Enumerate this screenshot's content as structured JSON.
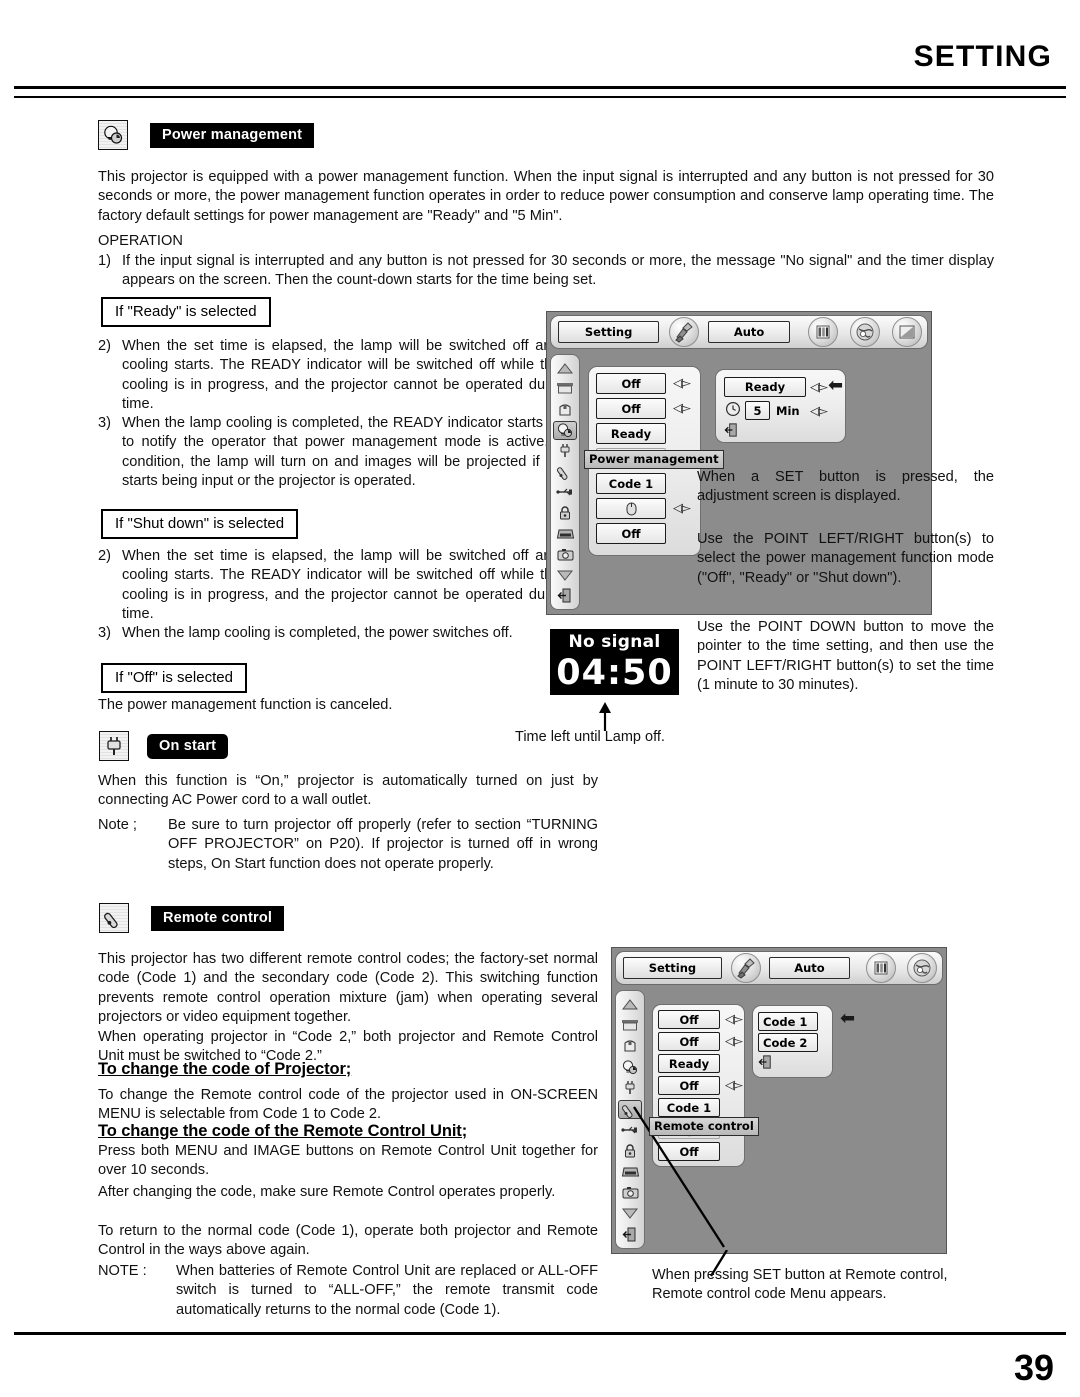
{
  "header": {
    "title": "SETTING"
  },
  "footer": {
    "page_number": "39"
  },
  "sections": {
    "power_management": {
      "icon": "power-management-icon",
      "label": "Power management",
      "intro": "This projector is equipped with a power management function. When the input signal is interrupted and any button is not pressed for 30 seconds or more, the power management function operates in order to reduce power consumption and conserve lamp operating time. The factory default settings for power management are \"Ready\" and \"5 Min\".",
      "operation_label": "OPERATION",
      "step1_num": "1)",
      "step1": "If the input signal is interrupted and any button is not pressed for 30 seconds or more, the message \"No signal\" and the timer display appears on the screen. Then the count-down starts for the time being set.",
      "ready_box": "If \"Ready\" is selected",
      "ready_step2_num": "2)",
      "ready_step2": "When the set time is elapsed, the lamp will be switched off and lamp cooling starts. The READY indicator will be switched off while the lamp cooling is in progress, and the projector cannot be operated during this time.",
      "ready_step3_num": "3)",
      "ready_step3": "When the lamp cooling is completed, the READY indicator starts flashing to notify the operator that power management mode is active. In this condition, the lamp will turn on and images will be projected if a signal starts being input or the projector is operated.",
      "shutdown_box": "If \"Shut down\" is selected",
      "shutdown_step2_num": "2)",
      "shutdown_step2": "When the set time is elapsed, the lamp will be switched off and lamp cooling starts. The READY indicator will be switched off while the lamp cooling is in progress, and the projector cannot be operated during this time.",
      "shutdown_step3_num": "3)",
      "shutdown_step3": "When the lamp cooling is completed, the power switches off.",
      "off_box": "If \"Off\" is selected",
      "off_text": "The power management function is canceled."
    },
    "on_start": {
      "icon": "power-plug-icon",
      "label": "On start",
      "body": "When this function is “On,” projector is automatically turned on just by connecting AC Power cord to a wall outlet.",
      "note_label": "Note ;",
      "note_body": "Be sure to turn projector off properly (refer to section “TURNING OFF PROJECTOR” on P20).  If projector is turned off in wrong steps, On Start function does not operate properly."
    },
    "remote_control": {
      "icon": "remote-control-icon",
      "label": "Remote control",
      "p1": "This projector has two different remote control codes; the factory-set normal code (Code 1) and the secondary code (Code 2).  This switching function prevents remote control operation mixture (jam) when operating several projectors or video equipment together.",
      "p2": "When operating projector in “Code 2,”  both projector and Remote Control Unit must be switched to “Code 2.”",
      "head1": "To change the code of Projector;",
      "p3": "To change the Remote control code of the projector used in ON-SCREEN MENU is selectable from Code 1 to Code 2.",
      "head2": "To change the code of the Remote Control Unit;",
      "p4": "Press both MENU and IMAGE buttons on Remote Control Unit together for over 10 seconds.",
      "p5": "After changing the code, make sure Remote Control operates properly.",
      "p6": "To return to the normal code (Code 1), operate both projector and Remote Control in the ways above again.",
      "note_label": "NOTE :",
      "note_body": "When batteries of Remote Control Unit are replaced or ALL-OFF switch is turned to “ALL-OFF,” the remote transmit code automatically returns to the normal code (Code 1)."
    }
  },
  "osd_top": {
    "menu_button": "Setting",
    "auto_button": "Auto",
    "sidebar_icons": [
      "scroll-up-icon",
      "screen-icon",
      "lamp-box-icon",
      "power-management-icon",
      "power-plug-icon",
      "remote-control-icon",
      "usb-icon",
      "lock-icon",
      "keystone-icon",
      "capture-icon",
      "scroll-down-icon",
      "exit-icon"
    ],
    "rows": [
      {
        "value": "Off",
        "has_lr": true
      },
      {
        "value": "Off",
        "has_lr": true
      },
      {
        "value": "Ready",
        "has_lr": false
      },
      {
        "value": "Off",
        "has_lr": true
      },
      {
        "value": "Code 1",
        "has_lr": false
      },
      {
        "value": "mouse-icon",
        "has_lr": true
      },
      {
        "value": "Off",
        "has_lr": false
      }
    ],
    "tooltip": "Power management",
    "submenu": {
      "mode": "Ready",
      "clock_icon": "clock-icon",
      "time_value": "5",
      "time_unit": "Min",
      "exit_icon": "exit-icon",
      "pointer_icon": "left-pointer-icon"
    }
  },
  "no_signal_panel": {
    "title": "No signal",
    "countdown": "04:50",
    "caption": "Time left until Lamp off."
  },
  "osd_top_notes": {
    "n1": "When a SET button is pressed, the adjustment screen is displayed.",
    "n2": "Use the POINT LEFT/RIGHT button(s) to select the power management function mode (\"Off\", \"Ready\" or \"Shut down\").",
    "n3": "Use the POINT DOWN button to move the pointer to the time setting, and then use the POINT LEFT/RIGHT button(s) to set the time (1 minute to 30 minutes)."
  },
  "osd_bottom": {
    "menu_button": "Setting",
    "auto_button": "Auto",
    "rows": [
      {
        "value": "Off",
        "has_lr": true
      },
      {
        "value": "Off",
        "has_lr": true
      },
      {
        "value": "Ready",
        "has_lr": false
      },
      {
        "value": "Off",
        "has_lr": true
      },
      {
        "value": "Code 1",
        "has_lr": false
      },
      {
        "value": "mouse-icon",
        "has_lr": true
      },
      {
        "value": "Off",
        "has_lr": false
      }
    ],
    "tooltip": "Remote control",
    "submenu": {
      "option1": "Code 1",
      "option2": "Code 2",
      "exit_icon": "exit-icon",
      "pointer_icon": "left-pointer-icon"
    },
    "caption": "When pressing SET button at Remote control, Remote control code Menu appears."
  },
  "colors": {
    "osd_background": "#8c8c8c",
    "badge_background": "#000000",
    "badge_text": "#ffffff",
    "no_signal_background": "#000000"
  }
}
